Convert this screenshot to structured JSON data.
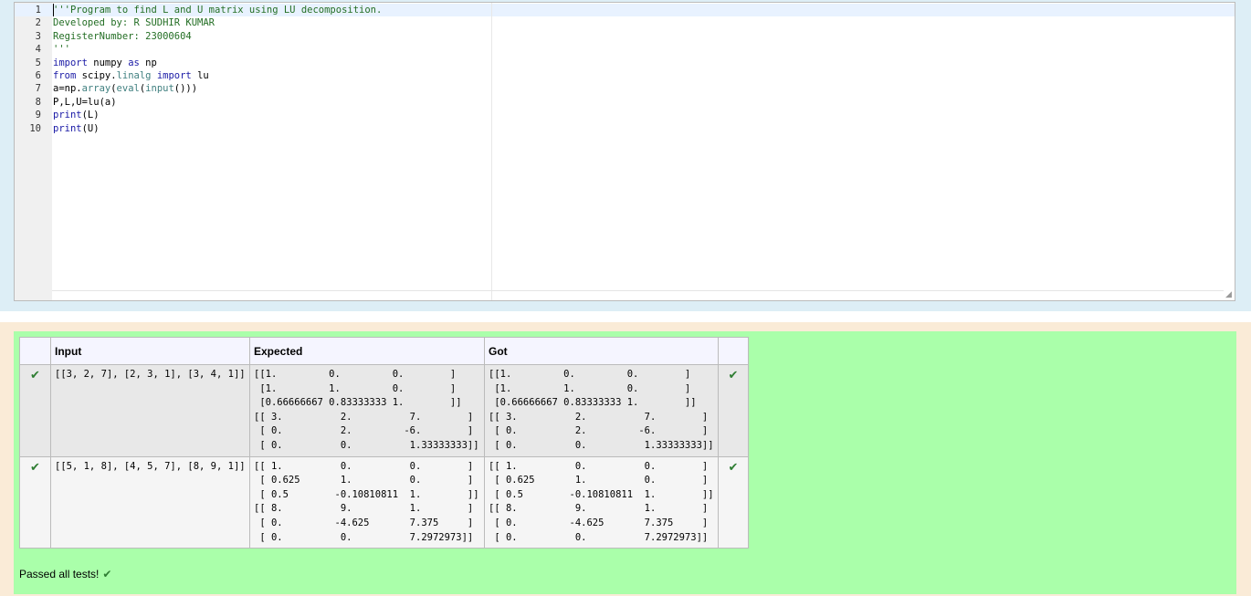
{
  "editor": {
    "lines": [
      {
        "num": "1",
        "parts": [
          {
            "t": "'''Program to find L and U matrix using LU decomposition.",
            "c": "c-com"
          }
        ]
      },
      {
        "num": "2",
        "parts": [
          {
            "t": "Developed by: R SUDHIR KUMAR",
            "c": "c-com"
          }
        ]
      },
      {
        "num": "3",
        "parts": [
          {
            "t": "RegisterNumber: 23000604",
            "c": "c-com"
          }
        ]
      },
      {
        "num": "4",
        "parts": [
          {
            "t": "'''",
            "c": "c-com"
          }
        ]
      },
      {
        "num": "5",
        "parts": [
          {
            "t": "import",
            "c": "c-kw"
          },
          {
            "t": " numpy ",
            "c": "c-plain"
          },
          {
            "t": "as",
            "c": "c-kw"
          },
          {
            "t": " np",
            "c": "c-plain"
          }
        ]
      },
      {
        "num": "6",
        "parts": [
          {
            "t": "from",
            "c": "c-kw"
          },
          {
            "t": " scipy.",
            "c": "c-plain"
          },
          {
            "t": "linalg",
            "c": "c-fn"
          },
          {
            "t": " ",
            "c": "c-plain"
          },
          {
            "t": "import",
            "c": "c-kw"
          },
          {
            "t": " lu",
            "c": "c-plain"
          }
        ]
      },
      {
        "num": "7",
        "parts": [
          {
            "t": "a=np.",
            "c": "c-plain"
          },
          {
            "t": "array",
            "c": "c-fn"
          },
          {
            "t": "(",
            "c": "c-plain"
          },
          {
            "t": "eval",
            "c": "c-fn"
          },
          {
            "t": "(",
            "c": "c-plain"
          },
          {
            "t": "input",
            "c": "c-fn"
          },
          {
            "t": "()))",
            "c": "c-plain"
          }
        ]
      },
      {
        "num": "8",
        "parts": [
          {
            "t": "P,L,U=lu(a)",
            "c": "c-plain"
          }
        ]
      },
      {
        "num": "9",
        "parts": [
          {
            "t": "print",
            "c": "c-kw"
          },
          {
            "t": "(L)",
            "c": "c-plain"
          }
        ]
      },
      {
        "num": "10",
        "parts": [
          {
            "t": "print",
            "c": "c-kw"
          },
          {
            "t": "(U)",
            "c": "c-plain"
          }
        ]
      }
    ]
  },
  "results": {
    "headers": {
      "input": "Input",
      "expected": "Expected",
      "got": "Got"
    },
    "rows": [
      {
        "input": "[[3, 2, 7], [2, 3, 1], [3, 4, 1]]",
        "expected": "[[1.         0.         0.        ]\n [1.         1.         0.        ]\n [0.66666667 0.83333333 1.        ]]\n[[ 3.          2.          7.        ]\n [ 0.          2.         -6.        ]\n [ 0.          0.          1.33333333]]",
        "got": "[[1.         0.         0.        ]\n [1.         1.         0.        ]\n [0.66666667 0.83333333 1.        ]]\n[[ 3.          2.          7.        ]\n [ 0.          2.         -6.        ]\n [ 0.          0.          1.33333333]]",
        "mark": "✔",
        "result": "✔"
      },
      {
        "input": "[[5, 1, 8], [4, 5, 7], [8, 9, 1]]",
        "expected": "[[ 1.          0.          0.        ]\n [ 0.625       1.          0.        ]\n [ 0.5        -0.10810811  1.        ]]\n[[ 8.          9.          1.        ]\n [ 0.         -4.625       7.375     ]\n [ 0.          0.          7.2972973]]",
        "got": "[[ 1.          0.          0.        ]\n [ 0.625       1.          0.        ]\n [ 0.5        -0.10810811  1.        ]]\n[[ 8.          9.          1.        ]\n [ 0.         -4.625       7.375     ]\n [ 0.          0.          7.2972973]]",
        "mark": "✔",
        "result": "✔"
      }
    ],
    "summary": "Passed all tests!",
    "summary_icon": "✔"
  }
}
